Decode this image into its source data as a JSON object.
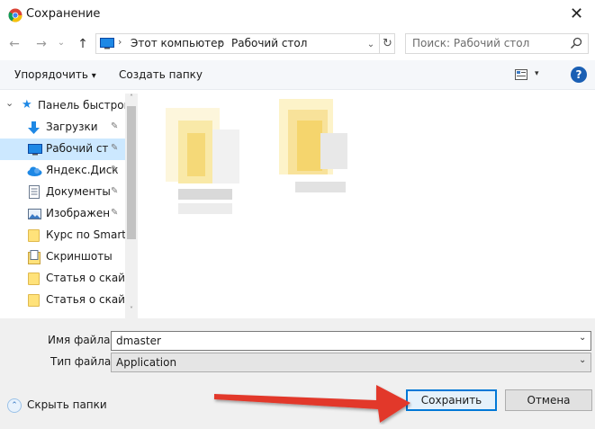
{
  "window": {
    "title": "Сохранение",
    "close_glyph": "✕",
    "icon": "chrome-icon"
  },
  "nav": {
    "back_glyph": "←",
    "forward_glyph": "→",
    "recent_glyph": "⌄",
    "up_glyph": "↑",
    "address": {
      "crumbs": [
        "Этот компьютер",
        "Рабочий стол"
      ],
      "separator": "›",
      "dropdown_glyph": "⌄",
      "refresh_glyph": "↻"
    },
    "search_placeholder": "Поиск: Рабочий стол"
  },
  "toolbar": {
    "organize_label": "Упорядочить",
    "organize_caret": "▾",
    "new_folder_label": "Создать папку",
    "view_caret": "▾",
    "help_glyph": "?"
  },
  "sidebar": {
    "items": [
      {
        "label": "Панель быстрого",
        "icon": "star-icon",
        "pinned": false,
        "expand": "⌄"
      },
      {
        "label": "Загрузки",
        "icon": "download-icon",
        "pinned": true
      },
      {
        "label": "Рабочий сто.",
        "icon": "desktop-icon",
        "pinned": true,
        "selected": true
      },
      {
        "label": "Яндекс.Диск",
        "icon": "cloud-icon",
        "pinned": true
      },
      {
        "label": "Документы",
        "icon": "documents-icon",
        "pinned": true
      },
      {
        "label": "Изображени",
        "icon": "pictures-icon",
        "pinned": true
      },
      {
        "label": "Курс по Smartre",
        "icon": "folder-icon",
        "pinned": false
      },
      {
        "label": "Скриншоты",
        "icon": "screenshots-icon",
        "pinned": false
      },
      {
        "label": "Статья о скайпе",
        "icon": "folder-icon",
        "pinned": false
      },
      {
        "label": "Статья о скайпе",
        "icon": "folder-icon",
        "pinned": false
      }
    ],
    "pin_glyph": "📌",
    "scroll_up": "˄",
    "scroll_down": "˅"
  },
  "form": {
    "filename_label": "Имя файла:",
    "filename_value": "dmaster",
    "filetype_label": "Тип файла:",
    "filetype_value": "Application",
    "dropdown_glyph": "⌄",
    "hide_folders_label": "Скрыть папки",
    "hide_folders_glyph": "⌃",
    "save_label": "Сохранить",
    "cancel_label": "Отмена"
  },
  "colors": {
    "selected_bg": "#cce8ff",
    "accent": "#0078d7",
    "annotation_arrow": "#e2372b"
  }
}
